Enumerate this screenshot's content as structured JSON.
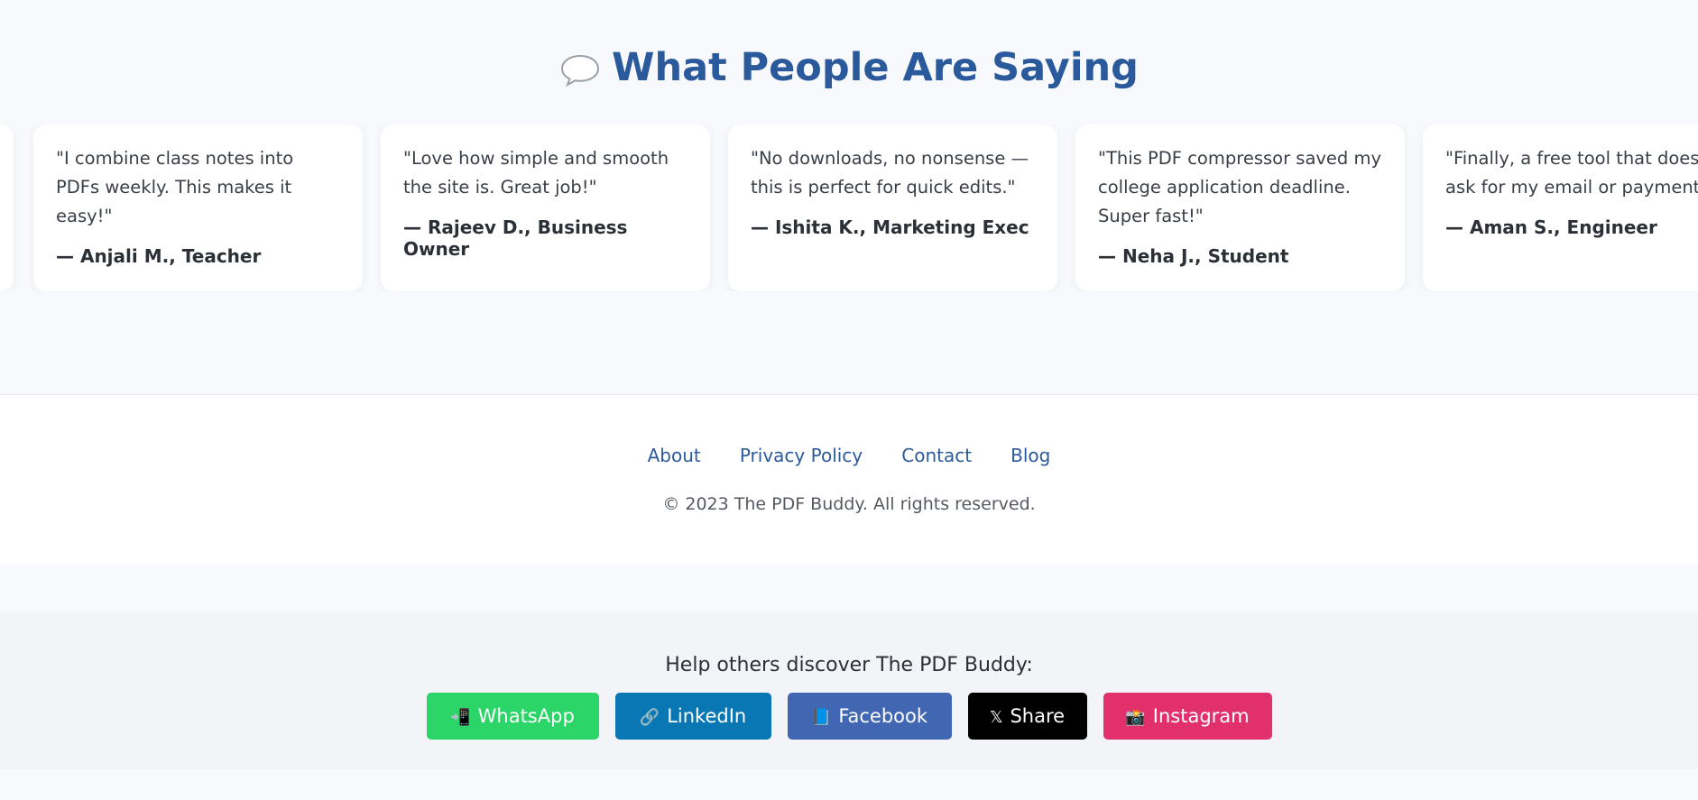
{
  "testimonials": {
    "title": "What People Are Saying",
    "title_icon": "speech-bubble-icon",
    "cards": [
      {
        "quote": "\"I combine class notes into PDFs weekly. This makes it easy!\"",
        "author": "— Anjali M., Teacher"
      },
      {
        "quote": "\"Love how simple and smooth the site is. Great job!\"",
        "author": "— Rajeev D., Business Owner"
      },
      {
        "quote": "\"No downloads, no nonsense — this is perfect for quick edits.\"",
        "author": "— Ishita K., Marketing Exec"
      },
      {
        "quote": "\"This PDF compressor saved my college application deadline. Super fast!\"",
        "author": "— Neha J., Student"
      },
      {
        "quote": "\"Finally, a free tool that doesn't ask for my email or payment.\"",
        "author": "— Aman S., Engineer"
      }
    ]
  },
  "footer": {
    "links": [
      "About",
      "Privacy Policy",
      "Contact",
      "Blog"
    ],
    "copyright": "© 2023 The PDF Buddy. All rights reserved."
  },
  "share": {
    "title": "Help others discover The PDF Buddy:",
    "buttons": [
      {
        "icon": "📲",
        "label": "WhatsApp",
        "color": "#2bd567"
      },
      {
        "icon": "🔗",
        "label": "LinkedIn",
        "color": "#0a77b5"
      },
      {
        "icon": "📘",
        "label": "Facebook",
        "color": "#4267b2"
      },
      {
        "icon": "𝕏",
        "label": "Share",
        "color": "#000000"
      },
      {
        "icon": "📸",
        "label": "Instagram",
        "color": "#e1306c"
      }
    ]
  },
  "colors": {
    "accent": "#2b5a9c",
    "page_bg": "#f8f9fc"
  }
}
